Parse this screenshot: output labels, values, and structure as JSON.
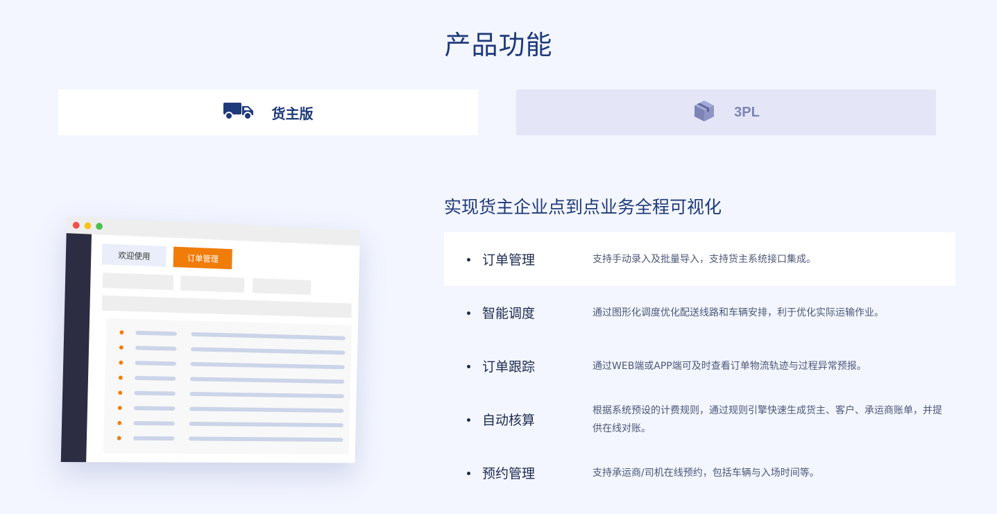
{
  "page": {
    "title": "产品功能"
  },
  "tabs": [
    {
      "label": "货主版",
      "icon": "truck-icon",
      "active": true
    },
    {
      "label": "3PL",
      "icon": "box-icon",
      "active": false
    }
  ],
  "illustration": {
    "tab_welcome": "欢迎使用",
    "tab_orders": "订单管理"
  },
  "section": {
    "title": "实现货主企业点到点业务全程可视化",
    "features": [
      {
        "name": "订单管理",
        "desc": "支持手动录入及批量导入，支持货主系统接口集成。",
        "active": true
      },
      {
        "name": "智能调度",
        "desc": "通过图形化调度优化配送线路和车辆安排，利于优化实际运输作业。",
        "active": false
      },
      {
        "name": "订单跟踪",
        "desc": "通过WEB端或APP端可及时查看订单物流轨迹与过程异常预报。",
        "active": false
      },
      {
        "name": "自动核算",
        "desc": "根据系统预设的计费规则，通过规则引擎快速生成货主、客户、承运商账单，并提供在线对账。",
        "active": false
      },
      {
        "name": "预约管理",
        "desc": "支持承运商/司机在线预约，包括车辆与入场时间等。",
        "active": false
      }
    ]
  },
  "colors": {
    "background": "#f3f6ff",
    "primary": "#1f3a7a",
    "accent": "#f07c0a",
    "tab_inactive": "#e4e6f7"
  }
}
